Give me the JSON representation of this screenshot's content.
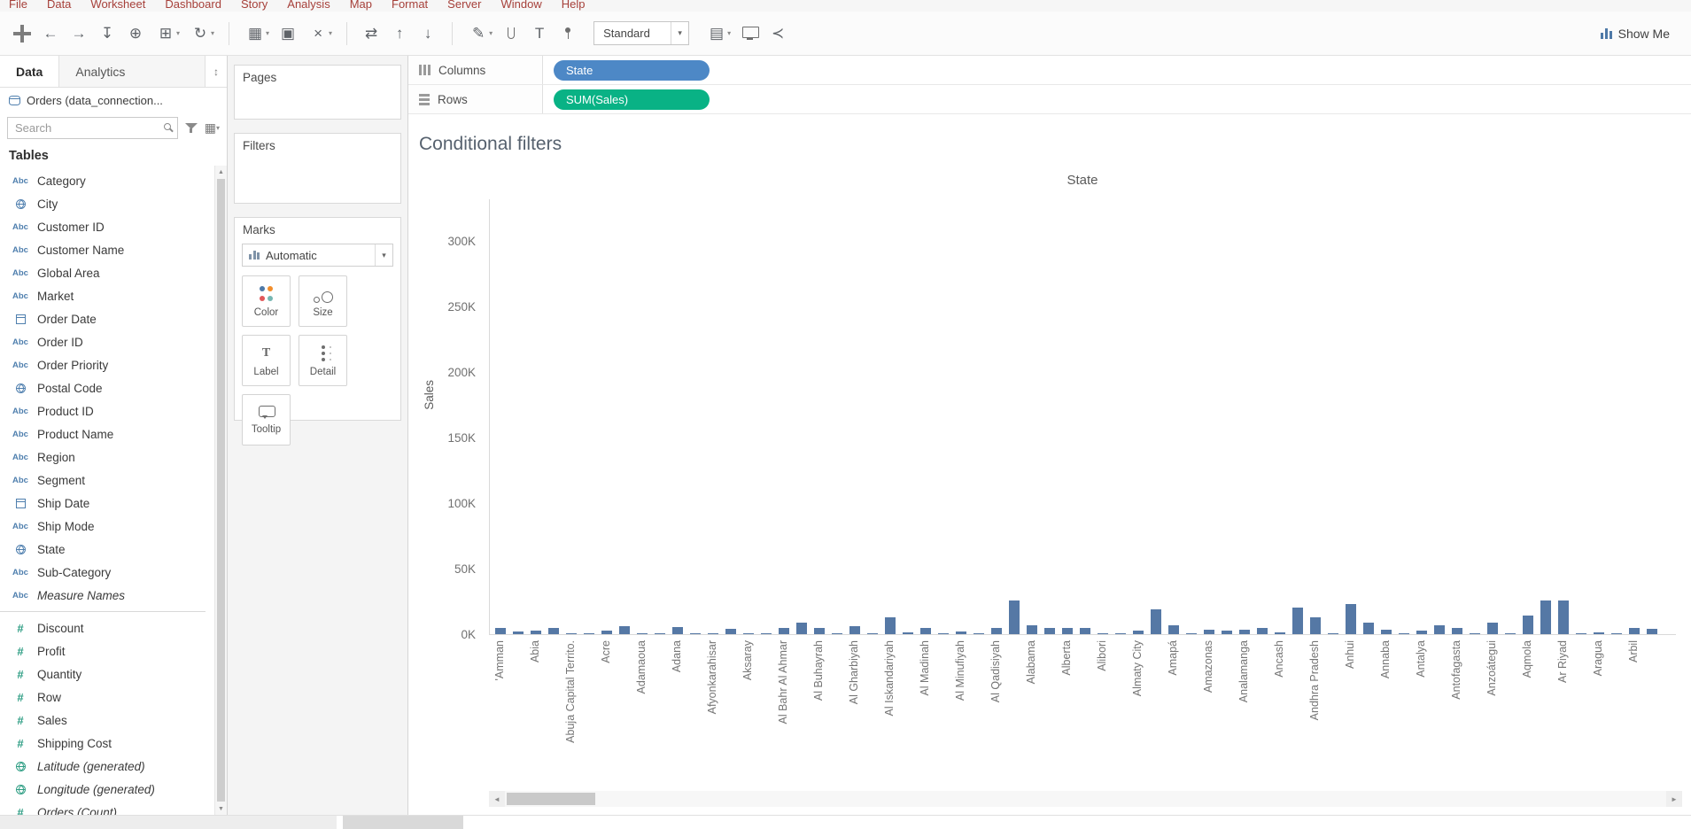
{
  "menu": {
    "items": [
      "File",
      "Data",
      "Worksheet",
      "Dashboard",
      "Story",
      "Analysis",
      "Map",
      "Format",
      "Server",
      "Window",
      "Help"
    ]
  },
  "icons": {
    "undo-icon": "←",
    "redo-icon": "→",
    "save-icon": "↧",
    "new-data-source-icon": "⊕",
    "new-worksheet-icon": "⊞",
    "refresh-icon": "↻",
    "new-sheet-icon": "▦",
    "duplicate-icon": "▣",
    "clear-sheet-icon": "×",
    "swap-axes-icon": "⇄",
    "sort-ascending-icon": "↑",
    "sort-descending-icon": "↓",
    "highlight-icon": "✎",
    "text-label-icon": "T",
    "fit-icon": "▤",
    "share-icon": "≺",
    "grid-view-icon": "▦",
    "pane-control-icon": "↕",
    "scroll-up-icon": "▲",
    "scroll-down-icon": "▼",
    "scroll-left-icon": "◄",
    "scroll-right-icon": "►"
  },
  "toolbar": {
    "standard_label": "Standard",
    "show_me_label": "Show Me"
  },
  "sidebar": {
    "tab_data": "Data",
    "tab_analytics": "Analytics",
    "data_source": "Orders (data_connection...",
    "search_placeholder": "Search",
    "tables_header": "Tables",
    "measures_divider_index": 19,
    "fields": [
      {
        "name": "Category",
        "icon": "abc",
        "role": "dimension",
        "italic": false
      },
      {
        "name": "City",
        "icon": "globe",
        "role": "dimension",
        "italic": false
      },
      {
        "name": "Customer ID",
        "icon": "abc",
        "role": "dimension",
        "italic": false
      },
      {
        "name": "Customer Name",
        "icon": "abc",
        "role": "dimension",
        "italic": false
      },
      {
        "name": "Global Area",
        "icon": "abc",
        "role": "dimension",
        "italic": false
      },
      {
        "name": "Market",
        "icon": "abc",
        "role": "dimension",
        "italic": false
      },
      {
        "name": "Order Date",
        "icon": "calendar",
        "role": "dimension",
        "italic": false
      },
      {
        "name": "Order ID",
        "icon": "abc",
        "role": "dimension",
        "italic": false
      },
      {
        "name": "Order Priority",
        "icon": "abc",
        "role": "dimension",
        "italic": false
      },
      {
        "name": "Postal Code",
        "icon": "globe",
        "role": "dimension",
        "italic": false
      },
      {
        "name": "Product ID",
        "icon": "abc",
        "role": "dimension",
        "italic": false
      },
      {
        "name": "Product Name",
        "icon": "abc",
        "role": "dimension",
        "italic": false
      },
      {
        "name": "Region",
        "icon": "abc",
        "role": "dimension",
        "italic": false
      },
      {
        "name": "Segment",
        "icon": "abc",
        "role": "dimension",
        "italic": false
      },
      {
        "name": "Ship Date",
        "icon": "calendar",
        "role": "dimension",
        "italic": false
      },
      {
        "name": "Ship Mode",
        "icon": "abc",
        "role": "dimension",
        "italic": false
      },
      {
        "name": "State",
        "icon": "globe",
        "role": "dimension",
        "italic": false
      },
      {
        "name": "Sub-Category",
        "icon": "abc",
        "role": "dimension",
        "italic": false
      },
      {
        "name": "Measure Names",
        "icon": "abc",
        "role": "dimension",
        "italic": true
      },
      {
        "name": "Discount",
        "icon": "hash",
        "role": "measure",
        "italic": false
      },
      {
        "name": "Profit",
        "icon": "hash",
        "role": "measure",
        "italic": false
      },
      {
        "name": "Quantity",
        "icon": "hash",
        "role": "measure",
        "italic": false
      },
      {
        "name": "Row",
        "icon": "hash",
        "role": "measure",
        "italic": false
      },
      {
        "name": "Sales",
        "icon": "hash",
        "role": "measure",
        "italic": false
      },
      {
        "name": "Shipping Cost",
        "icon": "hash",
        "role": "measure",
        "italic": false
      },
      {
        "name": "Latitude (generated)",
        "icon": "globe",
        "role": "measure",
        "italic": true
      },
      {
        "name": "Longitude (generated)",
        "icon": "globe",
        "role": "measure",
        "italic": true
      },
      {
        "name": "Orders (Count)",
        "icon": "hash",
        "role": "measure",
        "italic": true
      }
    ]
  },
  "cards": {
    "pages_label": "Pages",
    "filters_label": "Filters",
    "marks_label": "Marks",
    "marks_dropdown": "Automatic",
    "marks_buttons": [
      {
        "label": "Color",
        "icon": "color-icon"
      },
      {
        "label": "Size",
        "icon": "size-icon"
      },
      {
        "label": "Label",
        "icon": "label-icon"
      },
      {
        "label": "Detail",
        "icon": "detail-icon"
      },
      {
        "label": "Tooltip",
        "icon": "tooltip-icon"
      }
    ]
  },
  "shelves": {
    "columns_label": "Columns",
    "rows_label": "Rows",
    "columns_pills": [
      {
        "label": "State",
        "color": "#4d88c6"
      }
    ],
    "rows_pills": [
      {
        "label": "SUM(Sales)",
        "color": "#09b285"
      }
    ]
  },
  "chart_data": {
    "type": "bar",
    "title": "Conditional filters",
    "column_header": "State",
    "xlabel": "",
    "ylabel": "Sales",
    "y_ticks": [
      "0K",
      "50K",
      "100K",
      "150K",
      "200K",
      "250K",
      "300K"
    ],
    "ylim": [
      0,
      300000
    ],
    "grid": false,
    "legend": false,
    "bar_color": "#5578a5",
    "bars": [
      {
        "label": "'Amman",
        "value": 5000
      },
      {
        "label": "",
        "value": 2000
      },
      {
        "label": "Abia",
        "value": 2500
      },
      {
        "label": "",
        "value": 5000
      },
      {
        "label": "Abuja Capital Territo.",
        "value": 800
      },
      {
        "label": "",
        "value": 500
      },
      {
        "label": "Acre",
        "value": 3000
      },
      {
        "label": "",
        "value": 6000
      },
      {
        "label": "Adamaoua",
        "value": 700
      },
      {
        "label": "",
        "value": 600
      },
      {
        "label": "Adana",
        "value": 5500
      },
      {
        "label": "",
        "value": 600
      },
      {
        "label": "Afyonkarahisar",
        "value": 900
      },
      {
        "label": "",
        "value": 4000
      },
      {
        "label": "Aksaray",
        "value": 600
      },
      {
        "label": "",
        "value": 500
      },
      {
        "label": "Al Bahr Al Ahmar",
        "value": 5000
      },
      {
        "label": "",
        "value": 9000
      },
      {
        "label": "Al Buhayrah",
        "value": 4500
      },
      {
        "label": "",
        "value": 600
      },
      {
        "label": "Al Gharbiyah",
        "value": 6000
      },
      {
        "label": "",
        "value": 700
      },
      {
        "label": "Al Iskandariyah",
        "value": 13000
      },
      {
        "label": "",
        "value": 1500
      },
      {
        "label": "Al Madinah",
        "value": 4500
      },
      {
        "label": "",
        "value": 800
      },
      {
        "label": "Al Minufiyah",
        "value": 2000
      },
      {
        "label": "",
        "value": 700
      },
      {
        "label": "Al Qadisiyah",
        "value": 5000
      },
      {
        "label": "",
        "value": 26000
      },
      {
        "label": "Alabama",
        "value": 7000
      },
      {
        "label": "",
        "value": 4500
      },
      {
        "label": "Alberta",
        "value": 5000
      },
      {
        "label": "",
        "value": 4500
      },
      {
        "label": "Alibori",
        "value": 800
      },
      {
        "label": "",
        "value": 600
      },
      {
        "label": "Almaty City",
        "value": 2500
      },
      {
        "label": "",
        "value": 19000
      },
      {
        "label": "Amapá",
        "value": 7000
      },
      {
        "label": "",
        "value": 800
      },
      {
        "label": "Amazonas",
        "value": 3500
      },
      {
        "label": "",
        "value": 2500
      },
      {
        "label": "Analamanga",
        "value": 3500
      },
      {
        "label": "",
        "value": 4500
      },
      {
        "label": "Ancash",
        "value": 1500
      },
      {
        "label": "",
        "value": 20000
      },
      {
        "label": "Andhra Pradesh",
        "value": 13000
      },
      {
        "label": "",
        "value": 800
      },
      {
        "label": "Anhui",
        "value": 23000
      },
      {
        "label": "",
        "value": 9000
      },
      {
        "label": "Annaba",
        "value": 3500
      },
      {
        "label": "",
        "value": 700
      },
      {
        "label": "Antalya",
        "value": 2500
      },
      {
        "label": "",
        "value": 7000
      },
      {
        "label": "Antofagasta",
        "value": 4500
      },
      {
        "label": "",
        "value": 800
      },
      {
        "label": "Anzoátegui",
        "value": 9000
      },
      {
        "label": "",
        "value": 900
      },
      {
        "label": "Aqmola",
        "value": 14000
      },
      {
        "label": "",
        "value": 26000
      },
      {
        "label": "Ar Riyad",
        "value": 26000
      },
      {
        "label": "",
        "value": 800
      },
      {
        "label": "Aragua",
        "value": 1500
      },
      {
        "label": "",
        "value": 700
      },
      {
        "label": "Arbil",
        "value": 5000
      },
      {
        "label": "",
        "value": 4000
      }
    ]
  }
}
